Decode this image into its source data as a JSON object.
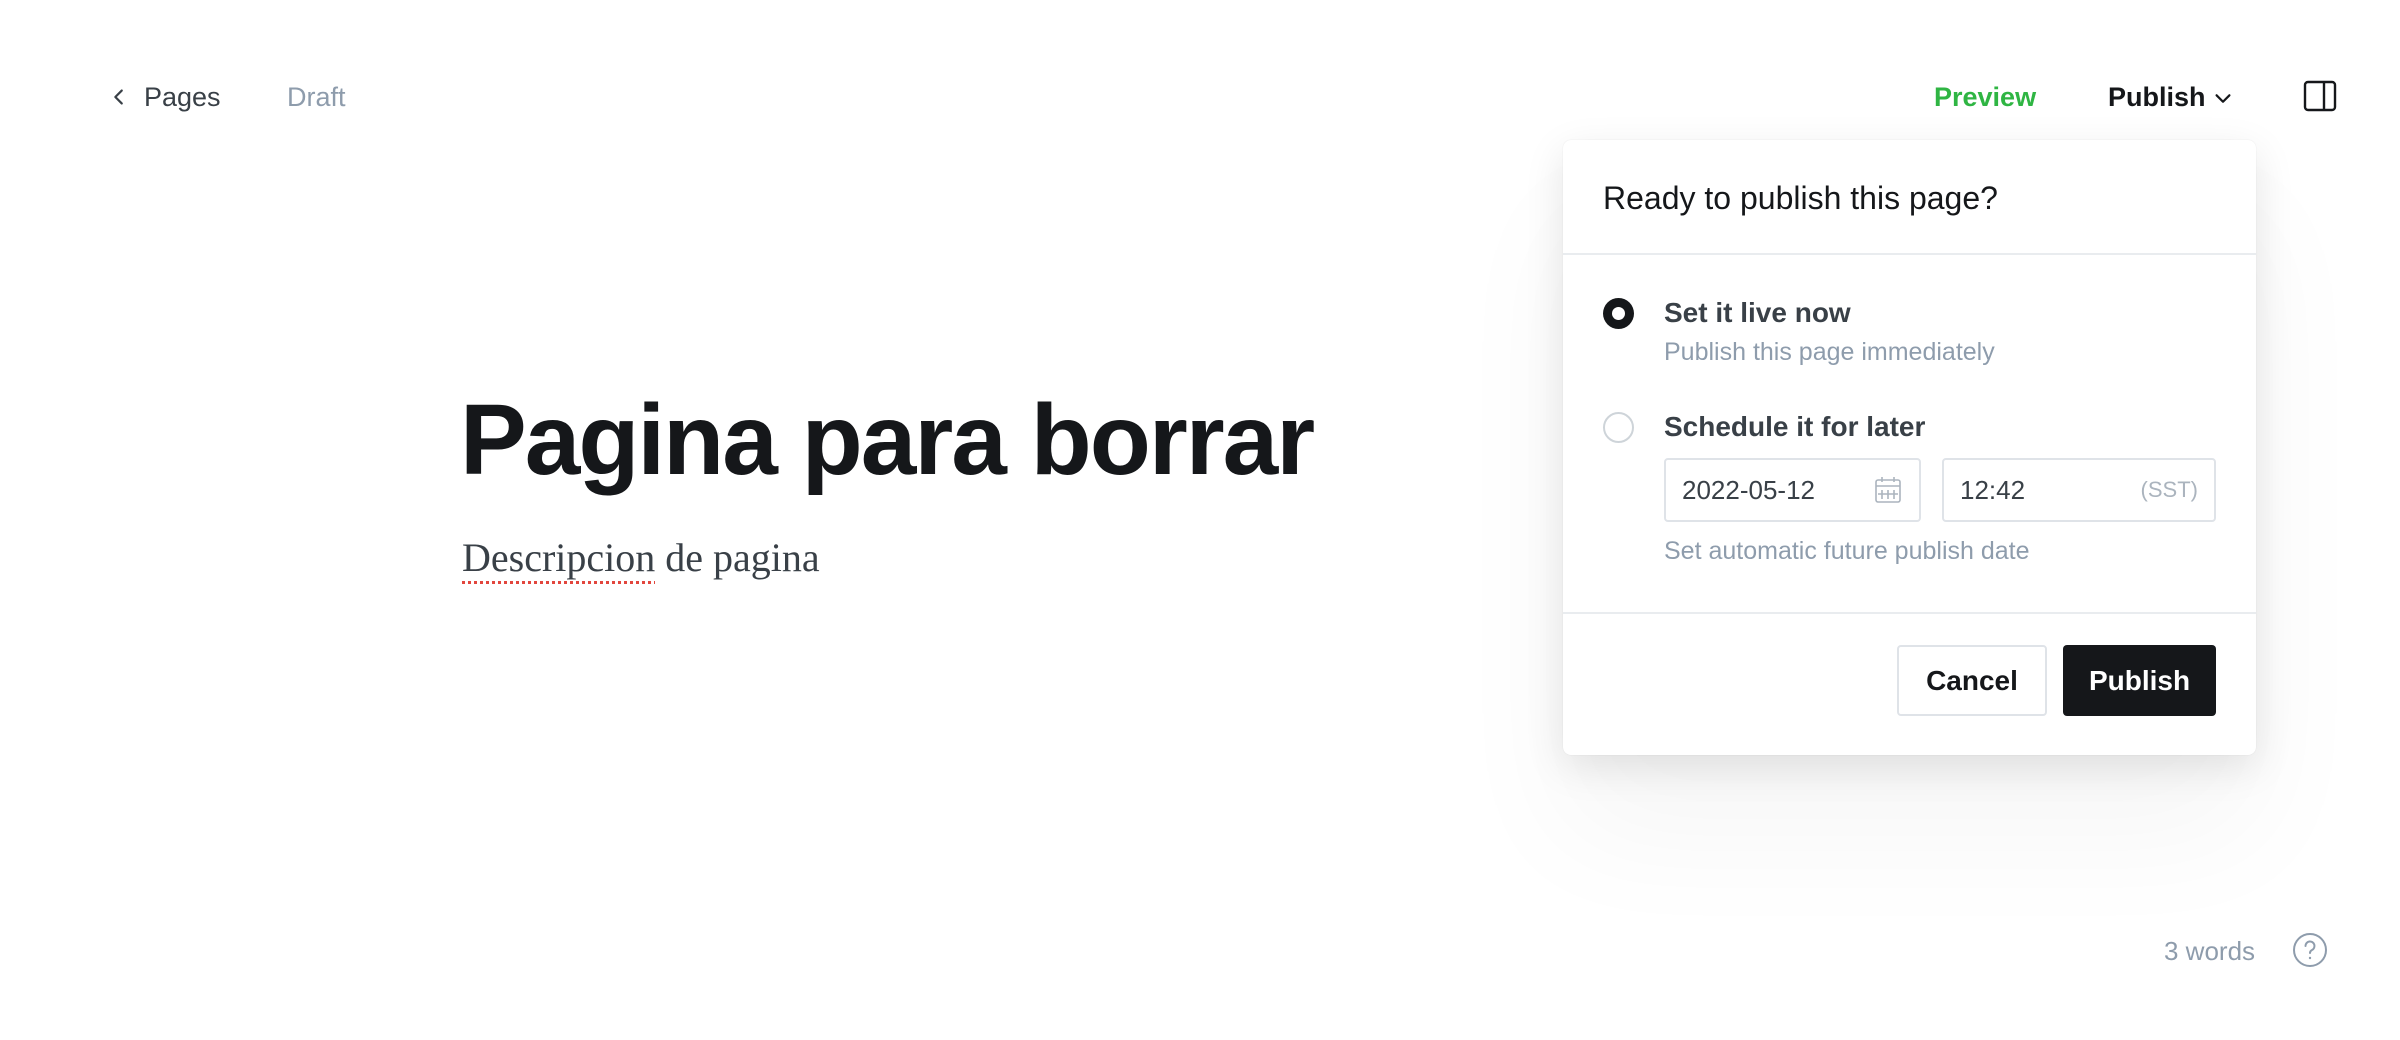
{
  "header": {
    "back_label": "Pages",
    "status": "Draft",
    "preview_label": "Preview",
    "publish_label": "Publish"
  },
  "editor": {
    "title": "Pagina para borrar",
    "excerpt_misspelled": "Descripcion",
    "excerpt_rest": " de pagina"
  },
  "footer": {
    "word_count": "3 words"
  },
  "publish_popover": {
    "title": "Ready to publish this page?",
    "options": [
      {
        "label": "Set it live now",
        "description": "Publish this page immediately",
        "selected": true
      },
      {
        "label": "Schedule it for later",
        "description": "Set automatic future publish date",
        "selected": false
      }
    ],
    "schedule": {
      "date": "2022-05-12",
      "time": "12:42",
      "timezone": "(SST)"
    },
    "cancel_label": "Cancel",
    "publish_label": "Publish"
  },
  "icons": {
    "back": "chevron-left-icon",
    "publish_dropdown": "chevron-down-icon",
    "sidebar": "sidebar-toggle-icon",
    "calendar": "calendar-icon",
    "help": "help-circle-icon"
  },
  "colors": {
    "accent_green": "#2fb543",
    "primary_dark": "#15171a",
    "muted_text": "#8e9cac",
    "border": "#dfe3e8"
  }
}
